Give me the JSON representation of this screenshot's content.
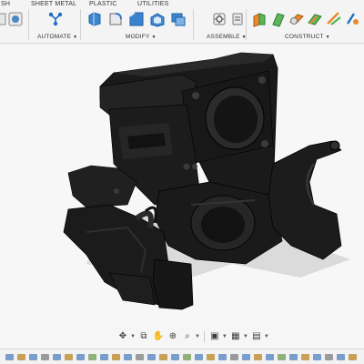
{
  "ribbon": {
    "tabs": [
      "SH",
      "SHEET METAL",
      "PLASTIC",
      "UTILITIES"
    ],
    "groups": {
      "automate": "AUTOMATE",
      "modify": "MODIFY",
      "assemble": "ASSEMBLE",
      "construct": "CONSTRUCT"
    },
    "tools": {
      "left_tool": "sheet-metal-tool-icon",
      "automate": "automate-icon",
      "modify": [
        "press-pull-icon",
        "fillet-icon",
        "chamfer-icon",
        "shell-icon",
        "combine-icon"
      ],
      "assemble": [
        "new-component-icon",
        "joint-icon"
      ],
      "construct": [
        "offset-plane-icon",
        "plane-at-angle-icon",
        "tangent-plane-icon",
        "midplane-icon",
        "axis-icon"
      ]
    },
    "accent_color": "#1f6fc5"
  },
  "navbar": {
    "icons": [
      "orbit-icon",
      "look-at-icon",
      "pan-icon",
      "zoom-icon",
      "fit-icon",
      "display-settings-icon",
      "grid-settings-icon",
      "viewports-icon"
    ]
  },
  "model": {
    "color": "#151515"
  }
}
